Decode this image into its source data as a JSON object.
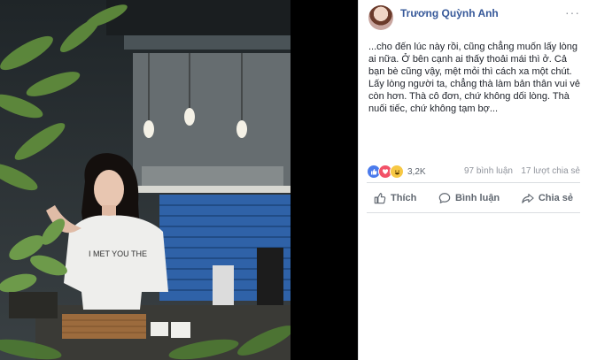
{
  "post": {
    "author": "Trương Quỳnh Anh",
    "more_label": "···",
    "text": "...cho đến lúc này rồi, cũng chẳng muốn lấy lòng ai nữa. Ở bên cạnh ai thấy thoải mái thì ở. Cả bạn bè cũng vậy, mệt mỏi thì cách xa một chút. Lấy lòng người ta, chẳng thà làm bản thân vui vẻ còn hơn. Thà cô đơn, chứ không dối lòng. Thà nuối tiếc, chứ không tạm bợ...",
    "reaction_count": "3,2K",
    "comments_count": "97 bình luận",
    "shares_count": "17 lượt chia sẻ"
  },
  "reactions": [
    {
      "icon": "like-reaction-icon",
      "color": "#4b7bec"
    },
    {
      "icon": "love-reaction-icon",
      "color": "#f25268"
    },
    {
      "icon": "haha-reaction-icon",
      "color": "#f7c844"
    }
  ],
  "actions": {
    "like": "Thích",
    "comment": "Bình luận",
    "share": "Chia sẻ"
  },
  "photo": {
    "shirt_text": "I MET YOU THE"
  },
  "colors": {
    "author_link": "#365899",
    "secondary_text": "#90949c",
    "action_text": "#606770",
    "background": "#000000"
  }
}
